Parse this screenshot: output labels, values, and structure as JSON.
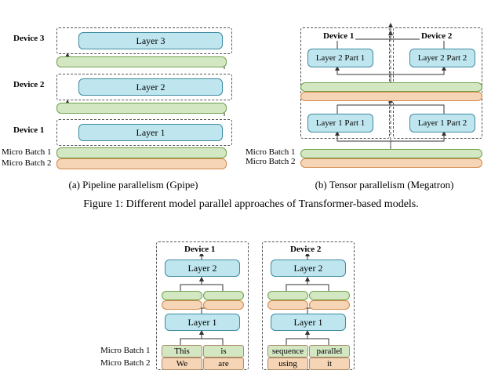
{
  "a": {
    "devices": [
      "Device 3",
      "Device 2",
      "Device 1"
    ],
    "layers": [
      "Layer 3",
      "Layer 2",
      "Layer 1"
    ],
    "mb": [
      "Micro Batch 1",
      "Micro Batch 2"
    ],
    "caption": "(a) Pipeline parallelism (Gpipe)"
  },
  "b": {
    "devices": [
      "Device 1",
      "Device 2"
    ],
    "parts": [
      "Layer 2 Part 1",
      "Layer 2 Part 2",
      "Layer 1 Part 1",
      "Layer 1 Part 2"
    ],
    "mb": [
      "Micro Batch 1",
      "Micro Batch 2"
    ],
    "caption": "(b) Tensor parallelism (Megatron)"
  },
  "caption1": "Figure 1: Different model parallel approaches of Transformer-based models.",
  "c": {
    "devices": [
      "Device 1",
      "Device 2"
    ],
    "layers": [
      "Layer 2",
      "Layer 2",
      "Layer 1",
      "Layer 1"
    ],
    "mb": [
      "Micro Batch 1",
      "Micro Batch 2"
    ],
    "words1": [
      "This",
      "is",
      "sequence",
      "parallel"
    ],
    "words2": [
      "We",
      "are",
      "using",
      "it"
    ]
  }
}
